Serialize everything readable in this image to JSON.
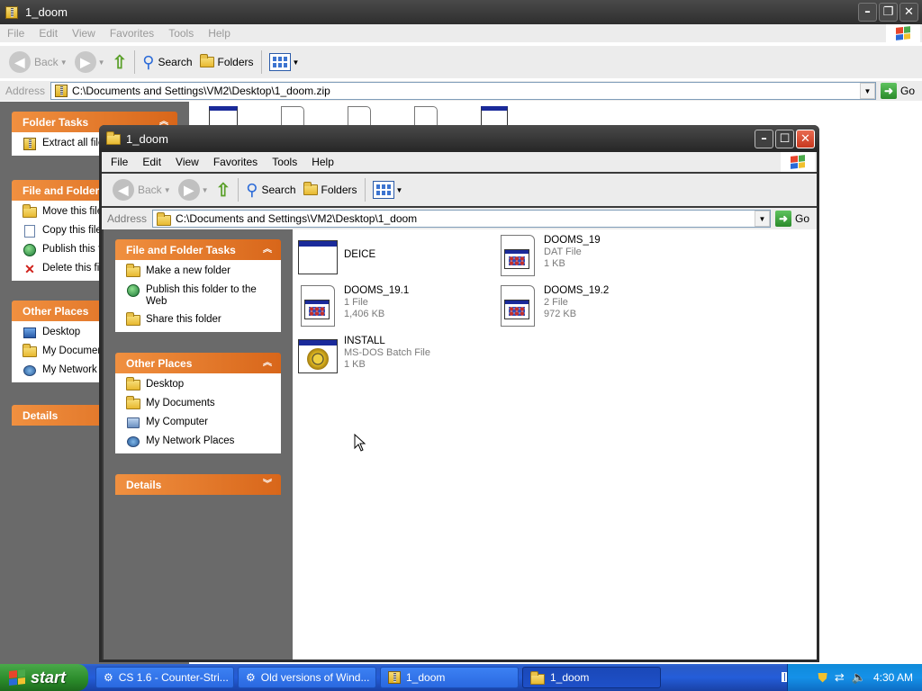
{
  "back_window": {
    "title": "1_doom",
    "menu": [
      "File",
      "Edit",
      "View",
      "Favorites",
      "Tools",
      "Help"
    ],
    "toolbar": {
      "back": "Back",
      "search": "Search",
      "folders": "Folders"
    },
    "address_label": "Address",
    "address": "C:\\Documents and Settings\\VM2\\Desktop\\1_doom.zip",
    "go": "Go",
    "folder_tasks_title": "Folder Tasks",
    "folder_tasks_items": [
      "Extract all files"
    ],
    "file_folder_title": "File and Folder Tasks",
    "file_folder_items": [
      "Move this file",
      "Copy this file",
      "Publish this file",
      "Delete this file"
    ],
    "other_places_title": "Other Places",
    "other_places_items": [
      "Desktop",
      "My Documents",
      "My Network Places"
    ],
    "details_title": "Details"
  },
  "front_window": {
    "title": "1_doom",
    "menu": [
      "File",
      "Edit",
      "View",
      "Favorites",
      "Tools",
      "Help"
    ],
    "toolbar": {
      "back": "Back",
      "search": "Search",
      "folders": "Folders"
    },
    "address_label": "Address",
    "address": "C:\\Documents and Settings\\VM2\\Desktop\\1_doom",
    "go": "Go",
    "file_folder_title": "File and Folder Tasks",
    "file_folder_items": [
      "Make a new folder",
      "Publish this folder to the Web",
      "Share this folder"
    ],
    "other_places_title": "Other Places",
    "other_places_items": [
      "Desktop",
      "My Documents",
      "My Computer",
      "My Network Places"
    ],
    "details_title": "Details",
    "files": [
      {
        "name": "DEICE",
        "type": "",
        "size": "",
        "icon": "app-window-icon"
      },
      {
        "name": "DOOMS_19",
        "type": "DAT File",
        "size": "1 KB",
        "icon": "data-file-icon"
      },
      {
        "name": "DOOMS_19.1",
        "type": "1 File",
        "size": "1,406 KB",
        "icon": "data-file-icon"
      },
      {
        "name": "DOOMS_19.2",
        "type": "2 File",
        "size": "972 KB",
        "icon": "data-file-icon"
      },
      {
        "name": "INSTALL",
        "type": "MS-DOS Batch File",
        "size": "1 KB",
        "icon": "batch-file-icon"
      }
    ]
  },
  "taskbar": {
    "start": "start",
    "items": [
      "CS 1.6 - Counter-Stri...",
      "Old versions of Wind...",
      "1_doom",
      "1_doom"
    ],
    "active_index": 3,
    "clock": "4:30 AM"
  },
  "colors": {
    "inactive_titlebar": "#3b3b3b",
    "active_titlebar": "#2b2b2b",
    "close_button": "#d9452b",
    "task_header": "#e8761a",
    "taskbar": "#245dd9",
    "start_button": "#2f8f2f"
  }
}
